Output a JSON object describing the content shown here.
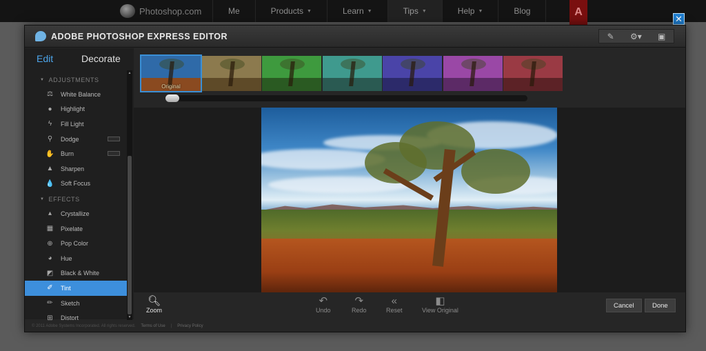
{
  "site": {
    "logo": "Photoshop.com",
    "nav": [
      {
        "label": "Me",
        "has_menu": false
      },
      {
        "label": "Products",
        "has_menu": true
      },
      {
        "label": "Learn",
        "has_menu": true
      },
      {
        "label": "Tips",
        "has_menu": true
      },
      {
        "label": "Help",
        "has_menu": true
      },
      {
        "label": "Blog",
        "has_menu": false
      }
    ],
    "adobe_logo": "A"
  },
  "window": {
    "title": "ADOBE PHOTOSHOP EXPRESS EDITOR",
    "close_glyph": "✕",
    "tools": [
      "brush-icon",
      "gear-icon",
      "fullscreen-icon"
    ]
  },
  "modes": {
    "edit": "Edit",
    "decorate": "Decorate",
    "active": "Edit"
  },
  "adjustments": {
    "heading": "ADJUSTMENTS",
    "items": [
      "White Balance",
      "Highlight",
      "Fill Light",
      "Dodge",
      "Burn",
      "Sharpen",
      "Soft Focus"
    ]
  },
  "effects": {
    "heading": "EFFECTS",
    "items": [
      "Crystallize",
      "Pixelate",
      "Pop Color",
      "Hue",
      "Black & White",
      "Tint",
      "Sketch",
      "Distort"
    ],
    "selected": "Tint"
  },
  "filmstrip": {
    "thumbnails": [
      {
        "label": "Original",
        "tint": "#2f6aa8",
        "ground": "#8a4a20",
        "selected": true
      },
      {
        "label": "",
        "tint": "#8c7a4e",
        "ground": "#5e4a28",
        "selected": false
      },
      {
        "label": "",
        "tint": "#3e9a3e",
        "ground": "#2a5a22",
        "selected": false
      },
      {
        "label": "",
        "tint": "#3f9a8e",
        "ground": "#2a5a52",
        "selected": false
      },
      {
        "label": "",
        "tint": "#4a44a8",
        "ground": "#2c2a6a",
        "selected": false
      },
      {
        "label": "",
        "tint": "#9a48a6",
        "ground": "#5c2a66",
        "selected": false
      },
      {
        "label": "",
        "tint": "#9a3a44",
        "ground": "#5c2226",
        "selected": false
      }
    ]
  },
  "bottom": {
    "zoom": "Zoom",
    "undo": "Undo",
    "redo": "Redo",
    "reset": "Reset",
    "view_original": "View Original",
    "cancel": "Cancel",
    "done": "Done"
  },
  "footer": {
    "copyright": "© 2011 Adobe Systems Incorporated. All rights reserved.",
    "terms": "Terms of Use",
    "privacy": "Privacy Policy"
  }
}
